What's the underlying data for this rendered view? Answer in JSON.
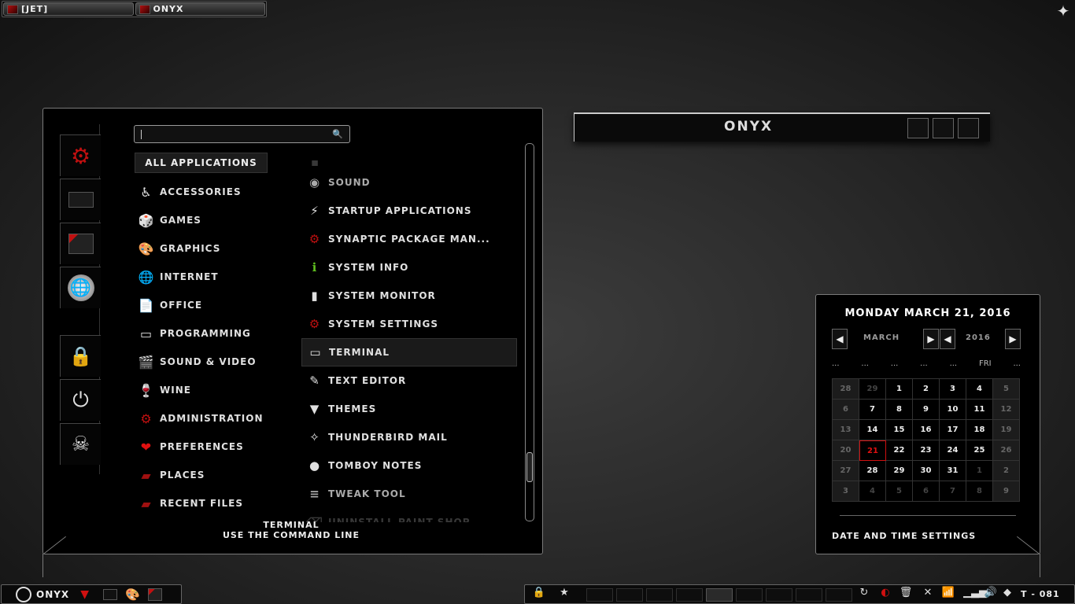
{
  "topbar": {
    "tabs": [
      {
        "label": "[JET]"
      },
      {
        "label": "ONYX"
      }
    ]
  },
  "menu": {
    "search": {
      "placeholder": ""
    },
    "all_apps_label": "ALL APPLICATIONS",
    "favorites": [
      {
        "icon": "red-gear-icon"
      },
      {
        "icon": "monitor-icon"
      },
      {
        "icon": "folder-icon"
      },
      {
        "icon": "globe-icon"
      },
      {
        "icon": "padlock-icon"
      },
      {
        "icon": "logout-icon"
      },
      {
        "icon": "skull-icon"
      }
    ],
    "categories": [
      {
        "label": "ACCESSORIES",
        "icon": "wheelchair-icon"
      },
      {
        "label": "GAMES",
        "icon": "dice-icon"
      },
      {
        "label": "GRAPHICS",
        "icon": "palette-icon"
      },
      {
        "label": "INTERNET",
        "icon": "globe-icon"
      },
      {
        "label": "OFFICE",
        "icon": "document-icon"
      },
      {
        "label": "PROGRAMMING",
        "icon": "window-icon"
      },
      {
        "label": "SOUND & VIDEO",
        "icon": "clapperboard-icon"
      },
      {
        "label": "WINE",
        "icon": "wineglass-icon"
      },
      {
        "label": "ADMINISTRATION",
        "icon": "red-gear-icon"
      },
      {
        "label": "PREFERENCES",
        "icon": "heart-icon"
      },
      {
        "label": "PLACES",
        "icon": "folder-icon"
      },
      {
        "label": "RECENT FILES",
        "icon": "folder-icon"
      }
    ],
    "apps": [
      {
        "label": "SOUND",
        "icon": "speaker-icon"
      },
      {
        "label": "STARTUP APPLICATIONS",
        "icon": "startup-icon"
      },
      {
        "label": "SYNAPTIC PACKAGE MAN...",
        "icon": "red-gear-icon"
      },
      {
        "label": "SYSTEM INFO",
        "icon": "info-icon"
      },
      {
        "label": "SYSTEM MONITOR",
        "icon": "monitor-bar-icon"
      },
      {
        "label": "SYSTEM SETTINGS",
        "icon": "red-gear-icon"
      },
      {
        "label": "TERMINAL",
        "icon": "terminal-icon"
      },
      {
        "label": "TEXT EDITOR",
        "icon": "text-editor-icon"
      },
      {
        "label": "THEMES",
        "icon": "tie-icon"
      },
      {
        "label": "THUNDERBIRD MAIL",
        "icon": "bird-icon"
      },
      {
        "label": "TOMBOY NOTES",
        "icon": "note-icon"
      },
      {
        "label": "TWEAK TOOL",
        "icon": "sliders-icon"
      },
      {
        "label": "UNINSTALL PAINT SHOP ...",
        "icon": "uninstall-icon"
      }
    ],
    "selected_app": "TERMINAL",
    "description": {
      "title": "TERMINAL",
      "text": "USE THE COMMAND LINE"
    }
  },
  "title_panel": {
    "title": "ONYX"
  },
  "calendar": {
    "date_heading": "MONDAY MARCH 21, 2016",
    "month": "MARCH",
    "year": "2016",
    "weekdays": [
      "...",
      "...",
      "...",
      "...",
      "...",
      "FRI",
      "..."
    ],
    "days": [
      [
        "28",
        "29",
        "1",
        "2",
        "3",
        "4",
        "5"
      ],
      [
        "6",
        "7",
        "8",
        "9",
        "10",
        "11",
        "12"
      ],
      [
        "13",
        "14",
        "15",
        "16",
        "17",
        "18",
        "19"
      ],
      [
        "20",
        "21",
        "22",
        "23",
        "24",
        "25",
        "26"
      ],
      [
        "27",
        "28",
        "29",
        "30",
        "31",
        "1",
        "2"
      ],
      [
        "3",
        "4",
        "5",
        "6",
        "7",
        "8",
        "9"
      ]
    ],
    "today": "21",
    "settings_label": "DATE AND TIME SETTINGS"
  },
  "bottom_left": {
    "label": "ONYX"
  },
  "tray": {
    "clock": "T - 081"
  },
  "colors": {
    "accent": "#d01010",
    "background": "#2a2a2a",
    "panel": "#000000"
  }
}
